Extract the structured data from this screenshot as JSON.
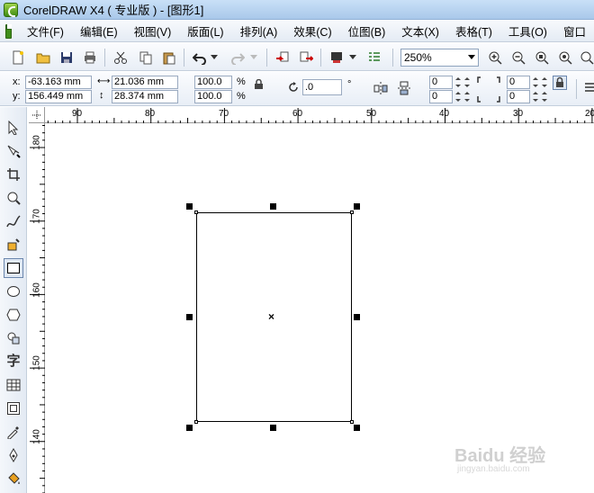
{
  "window": {
    "title": "CorelDRAW X4 ( 专业版 ) - [图形1]"
  },
  "menu": {
    "items": [
      "文件(F)",
      "编辑(E)",
      "视图(V)",
      "版面(L)",
      "排列(A)",
      "效果(C)",
      "位图(B)",
      "文本(X)",
      "表格(T)",
      "工具(O)",
      "窗口"
    ]
  },
  "toolbar": {
    "zoom_value": "250%"
  },
  "property_bar": {
    "x_label": "x:",
    "y_label": "y:",
    "x_value": "-63.163 mm",
    "y_value": "156.449 mm",
    "width_value": "21.036 mm",
    "height_value": "28.374 mm",
    "scale_x": "100.0",
    "scale_y": "100.0",
    "percent": "%",
    "rotation": ".0",
    "degree": "°",
    "corner_top_left": "0",
    "corner_bottom_left": "0",
    "corner_top_right": "0",
    "corner_bottom_right": "0"
  },
  "ruler": {
    "horizontal_labels": [
      "90",
      "80",
      "70",
      "60",
      "50",
      "40",
      "30",
      "20"
    ],
    "vertical_labels": [
      "180",
      "170",
      "160",
      "150",
      "140"
    ]
  },
  "toolbox": {
    "text_tool_glyph": "字"
  },
  "icons": {
    "new": "new-document-icon",
    "open": "open-icon",
    "save": "save-icon",
    "print": "print-icon",
    "cut": "cut-icon",
    "copy": "copy-icon",
    "paste": "paste-icon",
    "undo": "undo-icon",
    "redo": "redo-icon",
    "import": "import-icon",
    "export": "export-icon",
    "zoom_in": "zoom-in-icon",
    "zoom_out": "zoom-out-icon"
  },
  "watermark": {
    "text": "Baidu 经验",
    "sub": "jingyan.baidu.com"
  }
}
